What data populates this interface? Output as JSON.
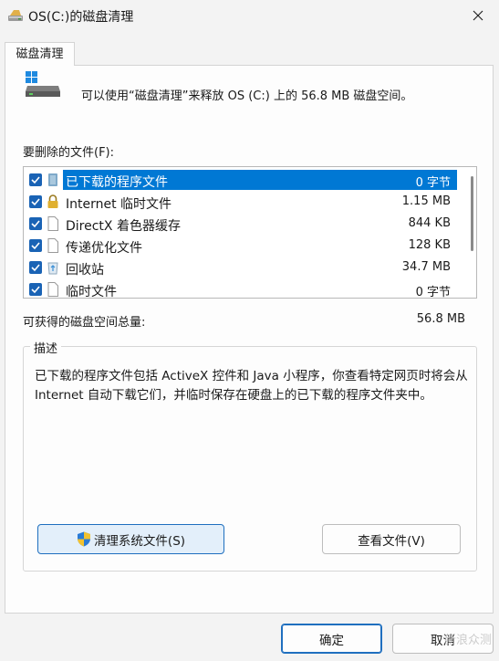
{
  "window": {
    "title": "OS(C:)的磁盘清理",
    "icon": "disk-cleanup-icon"
  },
  "tab": {
    "label": "磁盘清理"
  },
  "intro_text": "可以使用“磁盘清理”来释放 OS (C:) 上的 56.8 MB 磁盘空间。",
  "files_label": "要删除的文件(F):",
  "files": [
    {
      "name": "已下载的程序文件",
      "size": "0 字节",
      "checked": true,
      "selected": true,
      "icon": "folder-icon"
    },
    {
      "name": "Internet 临时文件",
      "size": "1.15 MB",
      "checked": true,
      "selected": false,
      "icon": "lock-icon"
    },
    {
      "name": "DirectX 着色器缓存",
      "size": "844 KB",
      "checked": true,
      "selected": false,
      "icon": "file-icon"
    },
    {
      "name": "传递优化文件",
      "size": "128 KB",
      "checked": true,
      "selected": false,
      "icon": "file-icon"
    },
    {
      "name": "回收站",
      "size": "34.7 MB",
      "checked": true,
      "selected": false,
      "icon": "recycle-bin-icon"
    },
    {
      "name": "临时文件",
      "size": "0 字节",
      "checked": true,
      "selected": false,
      "icon": "file-icon"
    }
  ],
  "total_label": "可获得的磁盘空间总量:",
  "total_value": "56.8 MB",
  "description": {
    "legend": "描述",
    "text": "已下载的程序文件包括 ActiveX 控件和 Java 小程序，你查看特定网页时将会从 Internet 自动下载它们，并临时保存在硬盘上的已下载的程序文件夹中。"
  },
  "buttons": {
    "clean_system": "清理系统文件(S)",
    "view_files": "查看文件(V)",
    "ok": "确定",
    "cancel": "取消"
  },
  "watermark": "新浪众测"
}
